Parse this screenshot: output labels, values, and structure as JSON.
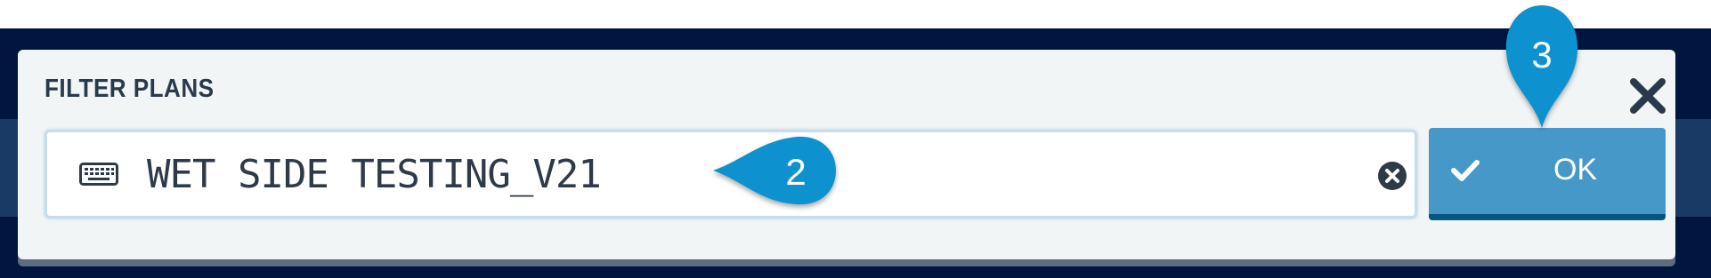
{
  "dialog": {
    "title": "FILTER PLANS",
    "close_icon": "close-icon"
  },
  "filter_input": {
    "value": "WET SIDE TESTING_V21",
    "leading_icon": "keyboard-icon",
    "clear_icon": "clear-circle-icon"
  },
  "ok_button": {
    "label": "OK",
    "icon": "check-icon"
  },
  "callouts": {
    "step_input": "2",
    "step_ok": "3"
  },
  "colors": {
    "backdrop": "#011541",
    "dialog_bg": "#f1f5f6",
    "title": "#2a3a4d",
    "ok_button": "#4598c8",
    "ok_button_border": "#07567f",
    "callout": "#0a91cf"
  }
}
